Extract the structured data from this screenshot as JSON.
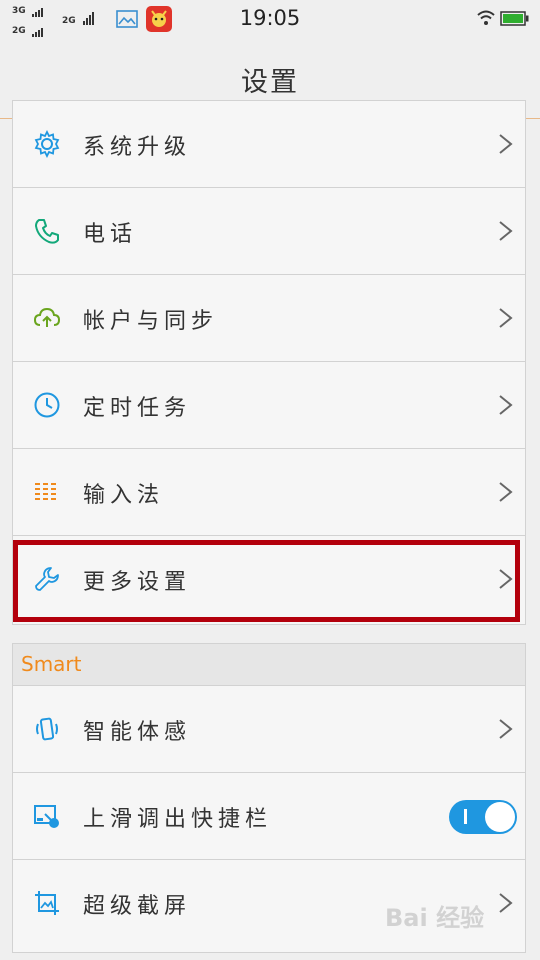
{
  "status_bar": {
    "network_top": "3G",
    "network_bottom": "2G",
    "network_mid": "2G",
    "time": "19:05",
    "icons": [
      "gallery-icon",
      "app-notification-icon",
      "wifi-icon",
      "battery-icon"
    ]
  },
  "header": {
    "title": "设置"
  },
  "system_group": {
    "items": [
      {
        "label": "系统升级",
        "icon": "gear-icon",
        "color": "#1f97e0"
      },
      {
        "label": "电话",
        "icon": "phone-icon",
        "color": "#13a87a"
      },
      {
        "label": "帐户与同步",
        "icon": "cloud-sync-icon",
        "color": "#6aa51e"
      },
      {
        "label": "定时任务",
        "icon": "clock-icon",
        "color": "#1f97e0"
      },
      {
        "label": "输入法",
        "icon": "keyboard-icon",
        "color": "#f08a1c"
      },
      {
        "label": "更多设置",
        "icon": "wrench-icon",
        "color": "#1f97e0"
      }
    ]
  },
  "smart_group": {
    "heading": "Smart",
    "items": [
      {
        "label": "智能体感",
        "icon": "motion-phone-icon",
        "control": "chevron"
      },
      {
        "label": "上滑调出快捷栏",
        "icon": "swipe-up-icon",
        "control": "toggle",
        "toggle_on": true
      },
      {
        "label": "超级截屏",
        "icon": "screenshot-icon",
        "control": "chevron"
      }
    ]
  },
  "watermark": "Bai 经验",
  "colors": {
    "accent": "#1f97e0",
    "section_heading": "#f08a1c",
    "highlight_border": "#b3000c"
  }
}
